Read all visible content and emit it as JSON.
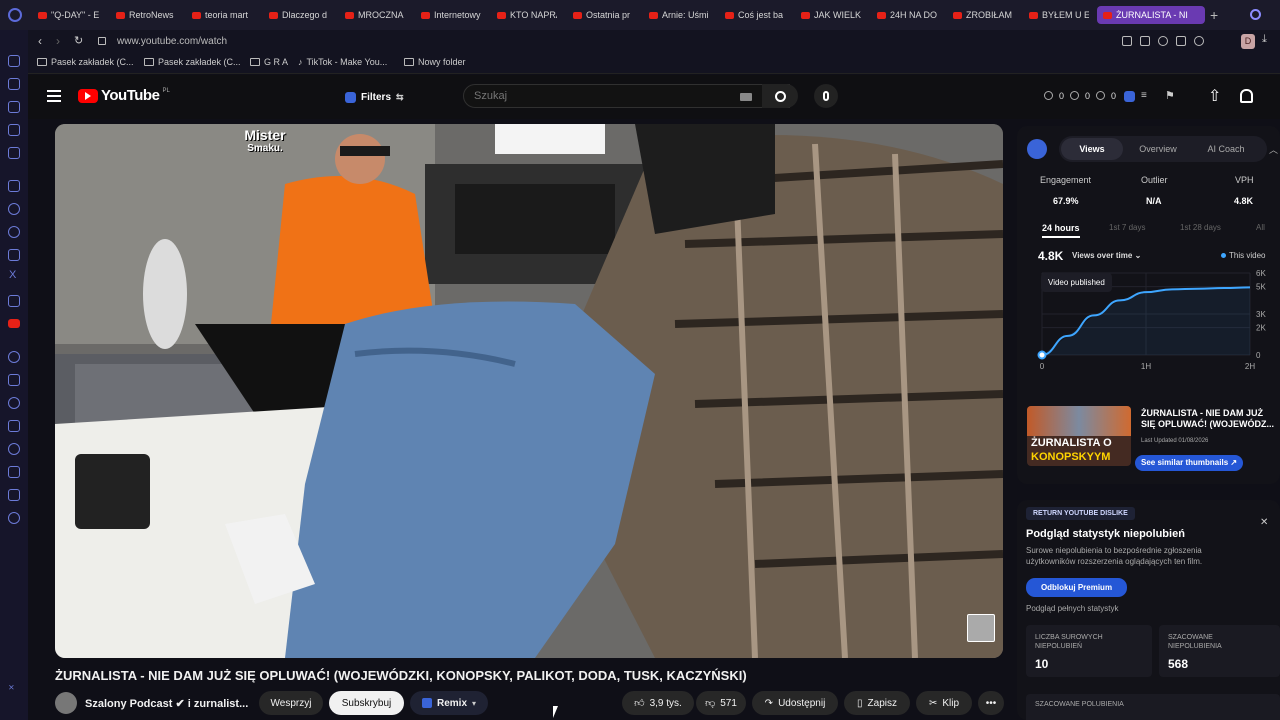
{
  "browser": {
    "tabs": [
      {
        "label": "\"Q-DAY\" - E"
      },
      {
        "label": "RetroNews"
      },
      {
        "label": "teoria mart"
      },
      {
        "label": "Dlaczego d"
      },
      {
        "label": "MROCZNA"
      },
      {
        "label": "Internetowy"
      },
      {
        "label": "KTO NAPRA"
      },
      {
        "label": "Ostatnia pr"
      },
      {
        "label": "Arnie: Uśmi"
      },
      {
        "label": "Coś jest ba"
      },
      {
        "label": "JAK WIELKI"
      },
      {
        "label": "24H NA DO"
      },
      {
        "label": "ZROBIŁAM"
      },
      {
        "label": "BYŁEM U E"
      },
      {
        "label": "ŻURNALISTA - NI"
      }
    ],
    "url": "www.youtube.com/watch",
    "profile_initial": "D",
    "bookmarks": [
      {
        "label": "Pasek zakładek (C..."
      },
      {
        "label": "Pasek zakładek (C..."
      },
      {
        "label": "G R A"
      },
      {
        "label": "TikTok - Make You..."
      },
      {
        "label": "Nowy folder"
      }
    ]
  },
  "youtube": {
    "logo_text": "YouTube",
    "logo_region": "PL",
    "filters_label": "Filters",
    "search_placeholder": "Szukaj",
    "header_counts": [
      "0",
      "0",
      "0"
    ]
  },
  "video": {
    "title": "ŻURNALISTA - NIE DAM JUŻ SIĘ OPLUWAĆ! (WOJEWÓDZKI, KONOPSKY, PALIKOT, DODA, TUSK, KACZYŃSKI)",
    "channel": "Szalony Podcast ✔ i zurnalist...",
    "support_label": "Wesprzyj",
    "subscribe_label": "Subskrybuj",
    "remix_label": "Remix",
    "likes": "3,9 tys.",
    "dislikes": "571",
    "share_label": "Udostępnij",
    "save_label": "Zapisz",
    "clip_label": "Klip",
    "logo_line1": "Mister",
    "logo_line2": "Smaku."
  },
  "analytics": {
    "tabs": [
      "Views",
      "Overview",
      "AI Coach"
    ],
    "metrics": [
      {
        "label": "Engagement",
        "value": "67.9%"
      },
      {
        "label": "Outlier",
        "value": "N/A"
      },
      {
        "label": "VPH",
        "value": "4.8K"
      }
    ],
    "ranges": [
      "24 hours",
      "1st 7 days",
      "1st 28 days",
      "All"
    ],
    "views_total": "4.8K",
    "views_dropdown": "Views over time",
    "legend_label": "This video",
    "tooltip": "Video published",
    "thumb_title": "ŻURNALISTA - NIE DAM JUŻ SIĘ OPLUWAĆ! (WOJEWÓDZ...",
    "thumb_updated": "Last Updated 01/08/2026",
    "thumb_text1": "ŻURNALISTA O",
    "thumb_text2": "KONOPSKYYM",
    "similar_button": "See similar thumbnails ↗"
  },
  "chart_data": {
    "type": "line",
    "title": "",
    "x_ticks": [
      "0",
      "1H",
      "2H"
    ],
    "y_ticks": [
      "6K",
      "5K",
      "3K",
      "2K",
      "0"
    ],
    "series": [
      {
        "name": "This video",
        "x": [
          0,
          0.25,
          0.5,
          0.75,
          1.0,
          1.25,
          1.5,
          1.75,
          2.0
        ],
        "y": [
          0,
          1400,
          2900,
          4000,
          4600,
          4800,
          4850,
          4900,
          4950
        ]
      }
    ],
    "xlim": [
      0,
      2
    ],
    "ylim": [
      0,
      6000
    ],
    "colors": {
      "line": "#3ea6ff"
    }
  },
  "dislike": {
    "header": "RETURN YOUTUBE DISLIKE",
    "title": "Podgląd statystyk niepolubień",
    "description": "Surowe niepolubienia to bezpośrednie zgłoszenia użytkowników rozszerzenia oglądających ten film.",
    "premium_button": "Odblokuj Premium",
    "full_stats": "Podgląd pełnych statystyk",
    "raw_label": "LICZBA SUROWYCH NIEPOLUBIEŃ",
    "raw_value": "10",
    "est_label": "SZACOWANE NIEPOLUBIENIA",
    "est_value": "568",
    "est_likes_label": "SZACOWANE POLUBIENIA"
  }
}
